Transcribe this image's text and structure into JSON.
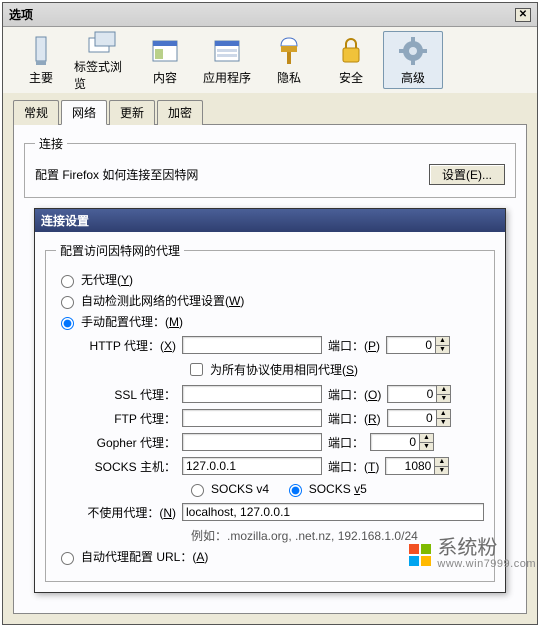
{
  "window": {
    "title": "选项",
    "close": "✕"
  },
  "toolbar": {
    "items": [
      {
        "label": "主要",
        "icon": "main"
      },
      {
        "label": "标签式浏览",
        "icon": "tabs"
      },
      {
        "label": "内容",
        "icon": "content"
      },
      {
        "label": "应用程序",
        "icon": "apps"
      },
      {
        "label": "隐私",
        "icon": "privacy"
      },
      {
        "label": "安全",
        "icon": "security"
      },
      {
        "label": "高级",
        "icon": "advanced"
      }
    ],
    "selected_index": 6
  },
  "tabs": {
    "items": [
      "常规",
      "网络",
      "更新",
      "加密"
    ],
    "active_index": 1
  },
  "connection": {
    "legend": "连接",
    "desc": "配置 Firefox 如何连接至因特网",
    "settings_btn": "设置(E)..."
  },
  "dialog": {
    "title": "连接设置",
    "fieldset_legend": "配置访问因特网的代理",
    "radio_none": {
      "label": "无代理(",
      "key": "Y",
      "suffix": ")"
    },
    "radio_auto": {
      "label": "自动检测此网络的代理设置(",
      "key": "W",
      "suffix": ")"
    },
    "radio_manual": {
      "label": "手动配置代理：(",
      "key": "M",
      "suffix": ")"
    },
    "selected_radio": "manual",
    "http": {
      "label": "HTTP 代理：(",
      "key": "X",
      "suffix": ")",
      "host": "",
      "port_label": "端口：(",
      "port_key": "P",
      "port_suffix": ")",
      "port": "0"
    },
    "same_proxy": {
      "label": "为所有协议使用相同代理(",
      "key": "S",
      "suffix": ")",
      "checked": false
    },
    "ssl": {
      "label": "SSL 代理：",
      "host": "",
      "port_label": "端口：(",
      "port_key": "O",
      "port_suffix": ")",
      "port": "0"
    },
    "ftp": {
      "label": "FTP 代理：",
      "host": "",
      "port_label": "端口：(",
      "port_key": "R",
      "port_suffix": ")",
      "port": "0"
    },
    "gopher": {
      "label": "Gopher 代理：",
      "host": "",
      "port_label": "端口：",
      "port": "0"
    },
    "socks": {
      "label": "SOCKS 主机：",
      "host": "127.0.0.1",
      "port_label": "端口：(",
      "port_key": "T",
      "port_suffix": ")",
      "port": "1080"
    },
    "socks_ver": {
      "v4": "SOCKS v4",
      "v5_pre": "SOCKS ",
      "v5_key": "v",
      "v5_post": "5",
      "selected": "v5"
    },
    "no_proxy": {
      "label": "不使用代理：(",
      "key": "N",
      "suffix": ")",
      "value": "localhost, 127.0.0.1",
      "example": "例如：.mozilla.org, .net.nz, 192.168.1.0/24"
    },
    "radio_url": {
      "label": "自动代理配置 URL：(",
      "key": "A",
      "suffix": ")"
    }
  },
  "watermark": {
    "text": "系统粉",
    "url": "www.win7999.com"
  }
}
